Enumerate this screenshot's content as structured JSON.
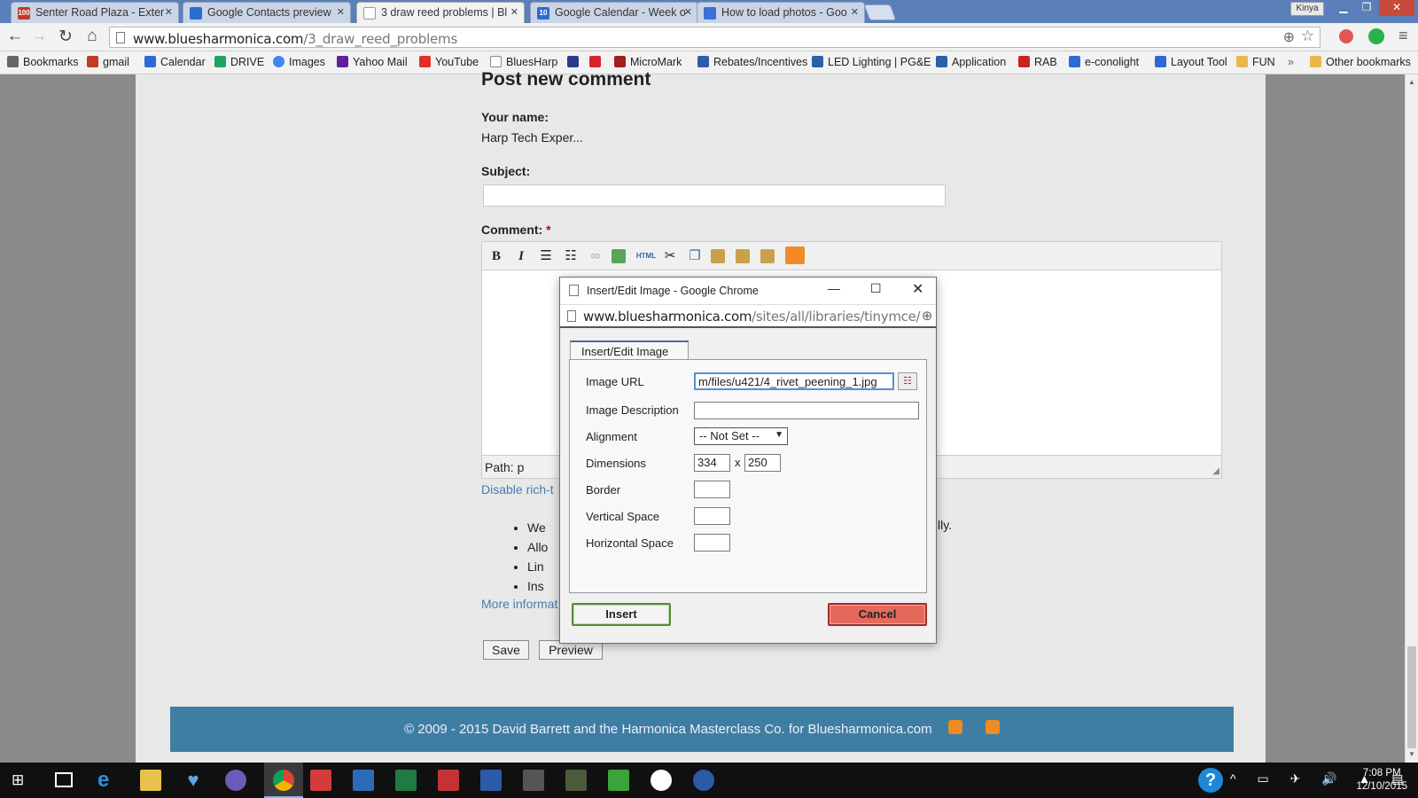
{
  "browser": {
    "tabs": [
      {
        "title": "Senter Road Plaza - Exter",
        "icon_color": "#c23b22",
        "icon_text": "100"
      },
      {
        "title": "Google Contacts preview",
        "icon_color": "#2f6ad4",
        "icon_text": ""
      },
      {
        "title": "3 draw reed problems | Bl",
        "icon_color": "#ffffff",
        "icon_text": ""
      },
      {
        "title": "Google Calendar - Week o",
        "icon_color": "#2f6ad4",
        "icon_text": "10"
      },
      {
        "title": "How to load photos - Goo",
        "icon_color": "#3a6fd8",
        "icon_text": ""
      }
    ],
    "profile_name": "Kinya",
    "url_host": "www.bluesharmonica.com",
    "url_path": "/3_draw_reed_problems",
    "bookmarks_label": "Bookmarks",
    "bookmarks": [
      {
        "label": "gmail",
        "color": "#c23b22"
      },
      {
        "label": "Calendar",
        "color": "#2f6ad4"
      },
      {
        "label": "DRIVE",
        "color": "#1fa463"
      },
      {
        "label": "Images",
        "color": "#4285f4"
      },
      {
        "label": "Yahoo Mail",
        "color": "#5f1f9f"
      },
      {
        "label": "YouTube",
        "color": "#e52d27"
      },
      {
        "label": "BluesHarp",
        "color": "#888888"
      },
      {
        "label": "",
        "color": "#2d3a8c"
      },
      {
        "label": "",
        "color": "#d9232e"
      },
      {
        "label": "MicroMark",
        "color": "#a01e1e"
      },
      {
        "label": "Rebates/Incentives",
        "color": "#2b5fa8"
      },
      {
        "label": "LED Lighting | PG&E",
        "color": "#2b5fa8"
      },
      {
        "label": "Application",
        "color": "#2b5fa8"
      },
      {
        "label": "RAB",
        "color": "#cc2222"
      },
      {
        "label": "e-conolight",
        "color": "#2f6ad4"
      },
      {
        "label": "Layout Tool",
        "color": "#2f6ad4"
      },
      {
        "label": "FUN",
        "color": "#e8b84a"
      }
    ],
    "other_bookmarks": "Other bookmarks"
  },
  "page": {
    "heading": "Post new comment",
    "your_name_label": "Your name:",
    "your_name_value": "Harp Tech Exper...",
    "subject_label": "Subject:",
    "comment_label": "Comment:",
    "required_mark": "*",
    "path_label": "Path: p",
    "disable_rich": "Disable rich-t",
    "bullets_left": [
      "We",
      "Allo",
      "Lin",
      "Ins"
    ],
    "bullet_right": "lly.",
    "more_info": "More informat",
    "save_label": "Save",
    "preview_label": "Preview",
    "footer_text": "© 2009 - 2015 David Barrett and the Harmonica Masterclass Co. for Bluesharmonica.com"
  },
  "dialog": {
    "window_title": "Insert/Edit Image - Google Chrome",
    "url_host": "www.bluesharmonica.com",
    "url_path": "/sites/all/libraries/tinymce/",
    "tab_label": "Insert/Edit Image",
    "fields": {
      "image_url_label": "Image URL",
      "image_url_value": "m/files/u421/4_rivet_peening_1.jpg",
      "description_label": "Image Description",
      "description_value": "",
      "alignment_label": "Alignment",
      "alignment_value": "-- Not Set --",
      "dimensions_label": "Dimensions",
      "width_value": "334",
      "dim_separator": "x",
      "height_value": "250",
      "border_label": "Border",
      "vspace_label": "Vertical Space",
      "hspace_label": "Horizontal Space"
    },
    "insert_label": "Insert",
    "cancel_label": "Cancel"
  },
  "taskbar": {
    "time": "7:08 PM",
    "date": "12/10/2015"
  }
}
